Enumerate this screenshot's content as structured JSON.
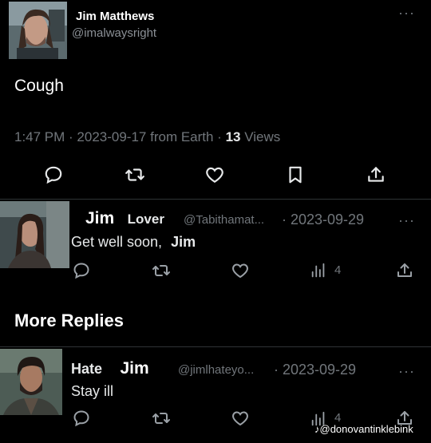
{
  "tweet": {
    "author_name": "Jim Matthews",
    "handle": "@imalwaysright",
    "body": "Cough",
    "meta_prefix": "1:47 PM · 2023-09-17 from Earth · ",
    "views_count": "13",
    "views_label": " Views"
  },
  "reply1": {
    "name_part1": "Jim",
    "name_part2": "Lover",
    "handle": "@Tabithamat...",
    "date": "· 2023-09-29",
    "body_prefix": "Get well soon, ",
    "body_name": "Jim",
    "views": "4"
  },
  "section": {
    "title": "More Replies"
  },
  "reply2": {
    "name_part1": "Hate",
    "name_part2": "Jim",
    "handle": "@jimlhateyo...",
    "date": "· 2023-09-29",
    "body": "Stay ill",
    "views": "4"
  },
  "watermark": {
    "text": "@donovantinklebink"
  },
  "icons": {
    "reply": "speech-bubble-icon",
    "retweet": "retweet-icon",
    "like": "heart-icon",
    "bookmark": "bookmark-icon",
    "share": "share-icon",
    "views": "bar-chart-icon",
    "more": "more-dots-icon",
    "tiktok": "tiktok-icon"
  }
}
